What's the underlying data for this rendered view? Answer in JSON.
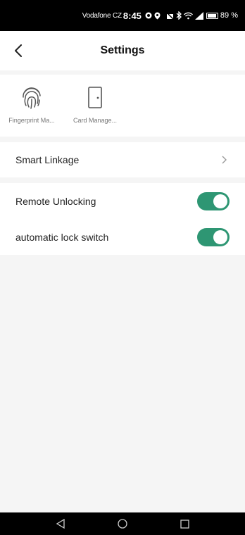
{
  "status_bar": {
    "carrier": "Vodafone CZ",
    "time": "8:45",
    "battery": "89 %"
  },
  "header": {
    "title": "Settings"
  },
  "devices": [
    {
      "label": "Fingerprint Ma...",
      "icon": "fingerprint-icon"
    },
    {
      "label": "Card Manage...",
      "icon": "door-card-icon"
    }
  ],
  "menu": {
    "smart_linkage": "Smart Linkage",
    "remote_unlocking": {
      "label": "Remote Unlocking",
      "enabled": true
    },
    "automatic_lock_switch": {
      "label": "automatic lock switch",
      "enabled": true
    }
  },
  "colors": {
    "toggle_on": "#2e9673",
    "background": "#f5f5f5"
  }
}
